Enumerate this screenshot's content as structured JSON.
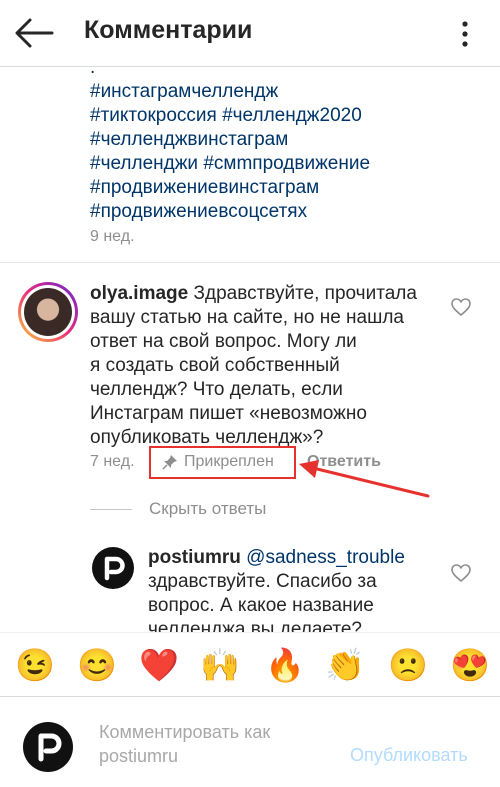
{
  "header": {
    "title": "Комментарии"
  },
  "caption": {
    "hashtag_lines": [
      ".",
      "#инстаграмчеллендж",
      "#тиктокроссия #челлендж2020",
      "#челленджвинстаграм",
      "#челленджи #смmпродвижение",
      "#продвижениевинстаграм",
      "#продвижениевсоцсетях"
    ],
    "time": "9 нед."
  },
  "comment": {
    "username": "olya.image",
    "lines": [
      "Здравствуйте, прочитала",
      "вашу статью на сайте, но не нашла",
      "ответ на свой вопрос. Могу ли",
      "я создать свой собственный",
      "челлендж? Что делать, если",
      "Инстаграм пишет «невозможно",
      "опубликовать челлендж»?"
    ],
    "time": "7 нед.",
    "pinned_label": "Прикреплен",
    "reply_label": "Ответить",
    "hide_replies": "Скрыть ответы"
  },
  "reply": {
    "username": "postiumru",
    "mention": "@sadness_trouble",
    "lines": [
      "здравствуйте. Спасибо за",
      "вопрос. А какое название",
      "челленджа вы делаете?"
    ]
  },
  "emojis": [
    "😉",
    "😊",
    "❤️",
    "🙌",
    "🔥",
    "👏",
    "🙁",
    "😍"
  ],
  "composer": {
    "placeholder_line1": "Комментировать как",
    "placeholder_line2": "postiumru",
    "publish_label": "Опубликовать"
  },
  "colors": {
    "highlight": "#e5322d",
    "link": "#003569",
    "publish": "#b3dbff"
  }
}
